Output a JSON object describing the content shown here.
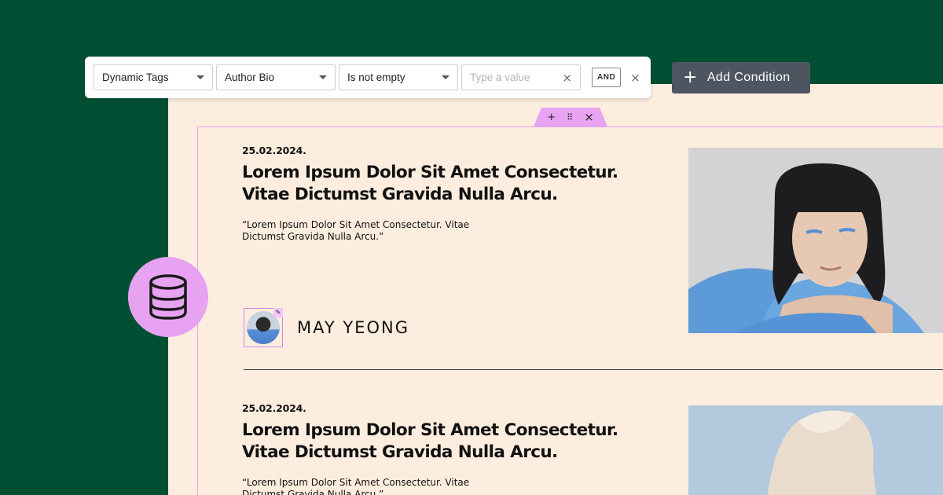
{
  "filter": {
    "select1": "Dynamic Tags",
    "select2": "Author Bio",
    "select3": "Is not empty",
    "value_placeholder": "Type a value",
    "and_label": "AND"
  },
  "add_condition_label": "Add Condition",
  "handle": {
    "add": "+",
    "move": "⠿",
    "close": "×"
  },
  "posts": [
    {
      "date": "25.02.2024.",
      "title": "Lorem Ipsum Dolor Sit Amet Consectetur. Vitae Dictumst Gravida Nulla Arcu.",
      "excerpt": "“Lorem Ipsum Dolor Sit Amet Consectetur. Vitae Dictumst Gravida Nulla Arcu.”",
      "author": "MAY YEONG"
    },
    {
      "date": "25.02.2024.",
      "title": "Lorem Ipsum Dolor Sit Amet Consectetur. Vitae Dictumst Gravida Nulla Arcu.",
      "excerpt": "“Lorem Ipsum Dolor Sit Amet Consectetur. Vitae Dictumst Gravida Nulla Arcu.”"
    }
  ],
  "colors": {
    "background": "#014f32",
    "canvas": "#fdeddf",
    "accent": "#e7a3f2",
    "button": "#4d5560"
  }
}
